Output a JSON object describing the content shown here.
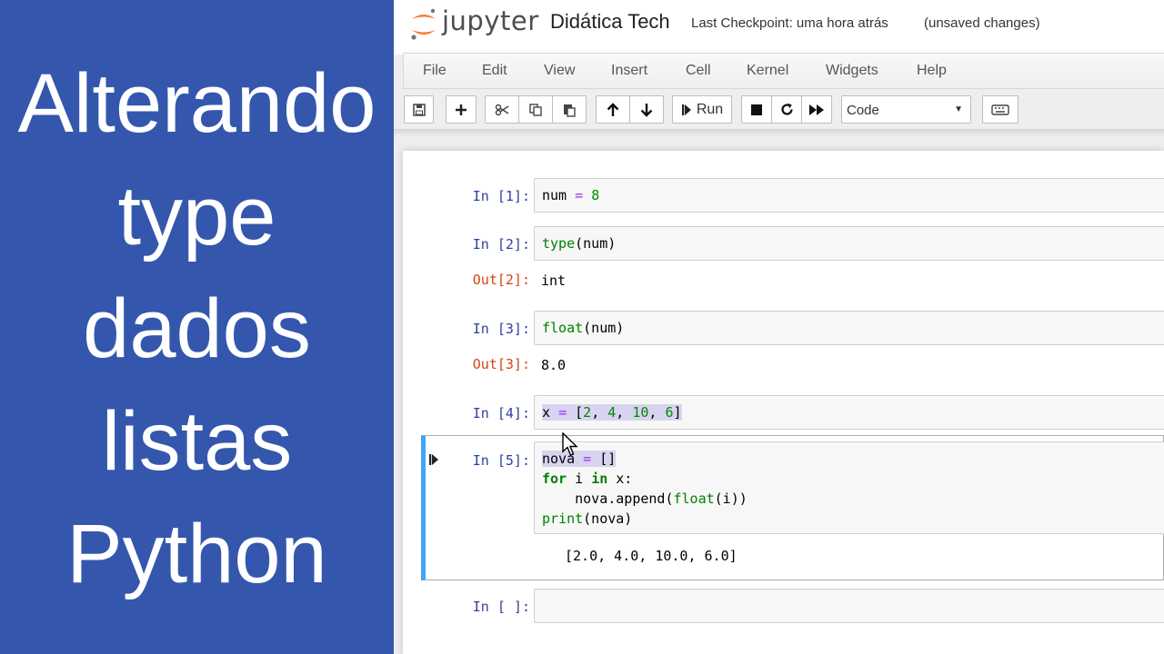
{
  "title_panel": {
    "lines": [
      "Alterando",
      "type",
      "dados",
      "listas",
      "Python"
    ]
  },
  "header": {
    "logo_text": "jupyter",
    "notebook_name": "Didática Tech",
    "checkpoint": "Last Checkpoint: uma hora atrás",
    "autosave_status": "(unsaved changes)"
  },
  "menubar": {
    "items": [
      "File",
      "Edit",
      "View",
      "Insert",
      "Cell",
      "Kernel",
      "Widgets",
      "Help"
    ]
  },
  "toolbar": {
    "run_label": "Run",
    "cell_type": "Code",
    "icons": [
      "save-icon",
      "plus-icon",
      "cut-icon",
      "copy-icon",
      "paste-icon",
      "arrow-up-icon",
      "arrow-down-icon",
      "step-forward-icon",
      "stop-icon",
      "restart-icon",
      "fast-forward-icon",
      "keyboard-icon"
    ]
  },
  "cells": [
    {
      "prompt": "In [1]:",
      "code": "num = 8"
    },
    {
      "prompt": "In [2]:",
      "code": "type(num)",
      "out_prompt": "Out[2]:",
      "output": "int"
    },
    {
      "prompt": "In [3]:",
      "code": "float(num)",
      "out_prompt": "Out[3]:",
      "output": "8.0"
    },
    {
      "prompt": "In [4]:",
      "code": "x = [2, 4, 10, 6]"
    },
    {
      "prompt": "In [5]:",
      "code": [
        "nova = []",
        "for i in x:",
        "    nova.append(float(i))",
        "print(nova)"
      ],
      "output": "[2.0, 4.0, 10.0, 6.0]"
    },
    {
      "prompt": "In [ ]:",
      "code": ""
    }
  ],
  "colors": {
    "title_panel_bg": "#3457ad",
    "in_prompt": "#303f9f",
    "out_prompt": "#d84315",
    "selected_cell_border": "#42a5f5"
  }
}
